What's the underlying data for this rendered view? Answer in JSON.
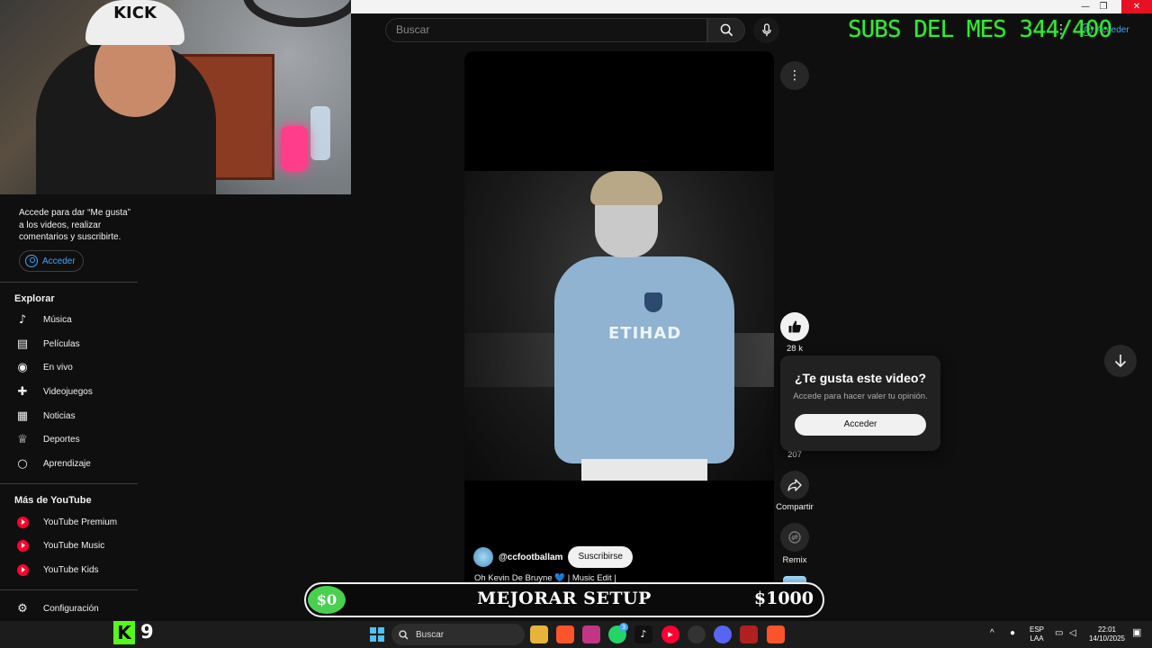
{
  "window": {
    "minimize": "—",
    "restore": "❐",
    "close": "✕"
  },
  "webcam": {
    "cap_text": "KICK"
  },
  "sidebar": {
    "signin_message": "Accede para dar “Me gusta” a los videos, realizar comentarios y suscribirte.",
    "signin_label": "Acceder",
    "explore_title": "Explorar",
    "explore_items": [
      {
        "label": "Música",
        "icon": "music-note-icon",
        "glyph": "♪"
      },
      {
        "label": "Películas",
        "icon": "film-icon",
        "glyph": "▤"
      },
      {
        "label": "En vivo",
        "icon": "live-icon",
        "glyph": "◉"
      },
      {
        "label": "Videojuegos",
        "icon": "gamepad-icon",
        "glyph": "✚"
      },
      {
        "label": "Noticias",
        "icon": "news-icon",
        "glyph": "▦"
      },
      {
        "label": "Deportes",
        "icon": "trophy-icon",
        "glyph": "♕"
      },
      {
        "label": "Aprendizaje",
        "icon": "bulb-icon",
        "glyph": "○"
      }
    ],
    "more_title": "Más de YouTube",
    "more_items": [
      {
        "label": "YouTube Premium",
        "icon": "youtube-premium-icon"
      },
      {
        "label": "YouTube Music",
        "icon": "youtube-music-icon"
      },
      {
        "label": "YouTube Kids",
        "icon": "youtube-kids-icon"
      }
    ],
    "settings_label": "Configuración"
  },
  "header": {
    "search_placeholder": "Buscar",
    "signin_label": "Acceder",
    "dots": "⋮"
  },
  "overlay": {
    "subs_text": "SUBS DEL MES 344/400",
    "goal_start": "$0",
    "goal_label": "MEJORAR SETUP",
    "goal_end": "$1000",
    "goal_progress": 0,
    "kick_logo": "K",
    "kick_count": "9"
  },
  "video": {
    "sponsor": "ETIHAD",
    "channel_name": "@ccfootballam",
    "subscribe_label": "Suscribirse",
    "title_prefix": "Oh Kevin De Bruyne",
    "title_heart": "💙",
    "title_suffix": "| Music Edit |"
  },
  "actions": {
    "more": "⋮",
    "like_count": "28 k",
    "comments_count": "207",
    "share_label": "Compartir",
    "remix_label": "Remix"
  },
  "popup": {
    "title": "¿Te gusta este video?",
    "subtitle": "Accede para hacer valer tu opinión.",
    "signin_label": "Acceder"
  },
  "taskbar": {
    "search_label": "Buscar",
    "lang_top": "ESP",
    "lang_bottom": "LAA",
    "time": "22:01",
    "date": "14/10/2025",
    "whatsapp_badge": "3"
  },
  "colors": {
    "youtube_red": "#ff0033",
    "link_blue": "#3ea6ff",
    "subs_green": "#39e639",
    "kick_green": "#53fc18",
    "goal_green": "#49d04f"
  }
}
